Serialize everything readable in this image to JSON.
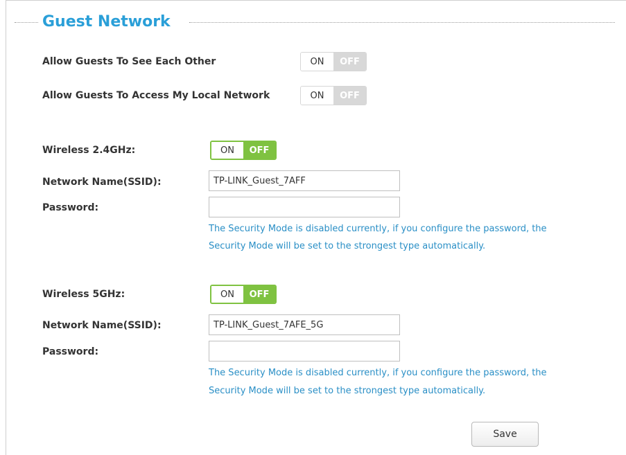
{
  "section": {
    "title": "Guest Network"
  },
  "guest_options": {
    "see_each_other": {
      "label": "Allow Guests To See Each Other",
      "on_label": "ON",
      "off_label": "OFF"
    },
    "access_local": {
      "label": "Allow Guests To Access My Local Network",
      "on_label": "ON",
      "off_label": "OFF"
    }
  },
  "wireless_24": {
    "label": "Wireless 2.4GHz:",
    "on_label": "ON",
    "off_label": "OFF",
    "ssid_label": "Network Name(SSID):",
    "ssid_value": "TP-LINK_Guest_7AFF",
    "password_label": "Password:",
    "password_value": "",
    "note_line1": "The Security Mode is disabled currently, if you configure the password, the",
    "note_line2": "Security Mode will be set to the strongest type automatically."
  },
  "wireless_5": {
    "label": "Wireless 5GHz:",
    "on_label": "ON",
    "off_label": "OFF",
    "ssid_label": "Network Name(SSID):",
    "ssid_value": "TP-LINK_Guest_7AFE_5G",
    "password_label": "Password:",
    "password_value": "",
    "note_line1": "The Security Mode is disabled currently, if you configure the password, the",
    "note_line2": "Security Mode will be set to the strongest type automatically."
  },
  "actions": {
    "save_label": "Save"
  },
  "colors": {
    "title": "#2a9fd8",
    "note": "#2a8fc6",
    "toggle_active": "#7fc241",
    "toggle_inactive": "#d8d8d8"
  }
}
